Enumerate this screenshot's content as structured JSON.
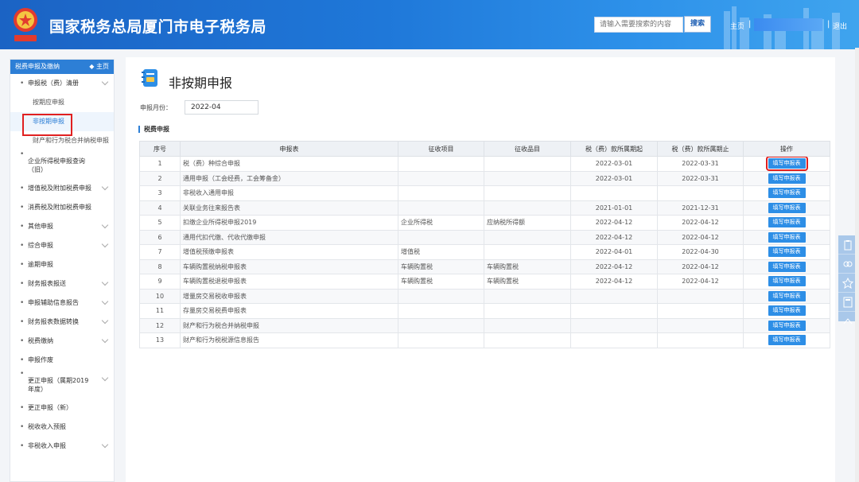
{
  "header": {
    "title": "国家税务总局厦门市电子税务局",
    "search_placeholder": "请输入需要搜索的内容",
    "search_btn": "搜索",
    "home": "主页",
    "sep": "|",
    "logout": "退出"
  },
  "sidebar": {
    "head": "税费申报及缴纳",
    "home": "主页",
    "items": [
      {
        "label": "申报税（费）清册",
        "type": "item",
        "chev": true
      },
      {
        "label": "按期应申报",
        "type": "sub"
      },
      {
        "label": "非按期申报",
        "type": "sub",
        "active": true
      },
      {
        "label": "财产和行为税合并纳税申报",
        "type": "sub"
      },
      {
        "label": "企业所得税申报查询（旧）",
        "type": "item2"
      },
      {
        "label": "增值税及附加税费申报",
        "type": "item",
        "chev": true
      },
      {
        "label": "消费税及附加税费申报",
        "type": "item"
      },
      {
        "label": "其他申报",
        "type": "item",
        "chev": true
      },
      {
        "label": "综合申报",
        "type": "item",
        "chev": true
      },
      {
        "label": "逾期申报",
        "type": "item"
      },
      {
        "label": "财务报表报送",
        "type": "item",
        "chev": true
      },
      {
        "label": "申报辅助信息报告",
        "type": "item",
        "chev": true
      },
      {
        "label": "财务报表数据转换",
        "type": "item",
        "chev": true
      },
      {
        "label": "税费缴纳",
        "type": "item",
        "chev": true
      },
      {
        "label": "申报作废",
        "type": "item"
      },
      {
        "label": "更正申报（属期2019年度）",
        "type": "item2",
        "chev": true
      },
      {
        "label": "更正申报（新）",
        "type": "item"
      },
      {
        "label": "税收收入预报",
        "type": "item"
      },
      {
        "label": "非税收入申报",
        "type": "item",
        "chev": true
      }
    ]
  },
  "main": {
    "title": "非按期申报",
    "month_label": "申报月份：",
    "month_value": "2022-04",
    "section": "税费申报",
    "columns": [
      "序号",
      "申报表",
      "征收项目",
      "征收品目",
      "税（费）款所属期起",
      "税（费）款所属期止",
      "操作"
    ],
    "rows": [
      [
        "1",
        "税（费）种综合申报",
        "",
        "",
        "2022-03-01",
        "2022-03-31"
      ],
      [
        "2",
        "通用申报（工会经费，工会筹备金）",
        "",
        "",
        "2022-03-01",
        "2022-03-31"
      ],
      [
        "3",
        "非税收入通用申报",
        "",
        "",
        "",
        ""
      ],
      [
        "4",
        "关联业务往来报告表",
        "",
        "",
        "2021-01-01",
        "2021-12-31"
      ],
      [
        "5",
        "扣缴企业所得税申报2019",
        "企业所得税",
        "应纳税所得额",
        "2022-04-12",
        "2022-04-12"
      ],
      [
        "6",
        "通用代扣代缴、代收代缴申报",
        "",
        "",
        "2022-04-12",
        "2022-04-12"
      ],
      [
        "7",
        "增值税预缴申报表",
        "增值税",
        "",
        "2022-04-01",
        "2022-04-30"
      ],
      [
        "8",
        "车辆购置税纳税申报表",
        "车辆购置税",
        "车辆购置税",
        "2022-04-12",
        "2022-04-12"
      ],
      [
        "9",
        "车辆购置税退税申报表",
        "车辆购置税",
        "车辆购置税",
        "2022-04-12",
        "2022-04-12"
      ],
      [
        "10",
        "增量房交易税收申报表",
        "",
        "",
        "",
        ""
      ],
      [
        "11",
        "存量房交易税费申报表",
        "",
        "",
        "",
        ""
      ],
      [
        "12",
        "财产和行为税合并纳税申报",
        "",
        "",
        "",
        ""
      ],
      [
        "13",
        "财产和行为税税源信息报告",
        "",
        "",
        "",
        ""
      ]
    ],
    "action_label": "填写申报表"
  },
  "colors": {
    "accent": "#2d7fd6",
    "highlight": "#e02020"
  }
}
